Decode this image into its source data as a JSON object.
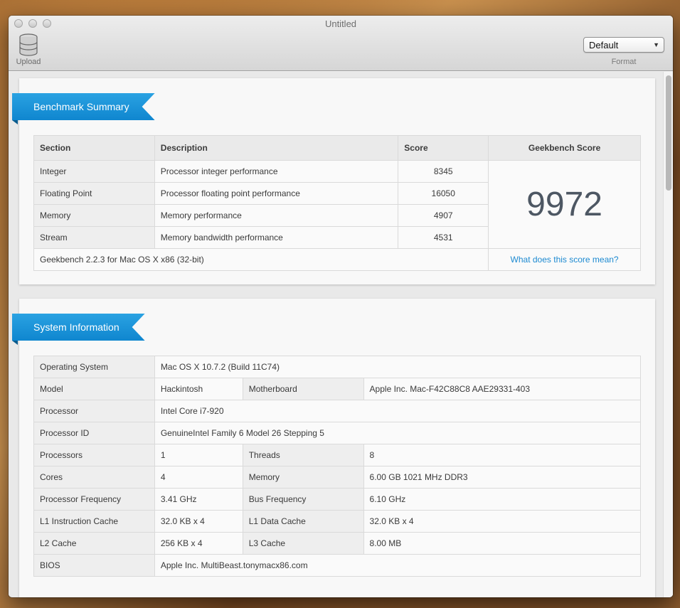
{
  "window": {
    "title": "Untitled"
  },
  "toolbar": {
    "upload_label": "Upload",
    "format_value": "Default",
    "format_label": "Format"
  },
  "summary": {
    "heading": "Benchmark Summary",
    "columns": [
      "Section",
      "Description",
      "Score",
      "Geekbench Score"
    ],
    "rows": [
      {
        "section": "Integer",
        "description": "Processor integer performance",
        "score": "8345"
      },
      {
        "section": "Floating Point",
        "description": "Processor floating point performance",
        "score": "16050"
      },
      {
        "section": "Memory",
        "description": "Memory performance",
        "score": "4907"
      },
      {
        "section": "Stream",
        "description": "Memory bandwidth performance",
        "score": "4531"
      }
    ],
    "geekbench_score": "9972",
    "version": "Geekbench 2.2.3 for Mac OS X x86 (32-bit)",
    "score_link": "What does this score mean?"
  },
  "system": {
    "heading": "System Information",
    "os_label": "Operating System",
    "os_value": "Mac OS X 10.7.2 (Build 11C74)",
    "model_label": "Model",
    "model_value": "Hackintosh",
    "motherboard_label": "Motherboard",
    "motherboard_value": "Apple Inc. Mac-F42C88C8 AAE29331-403",
    "processor_label": "Processor",
    "processor_value": "Intel Core i7-920",
    "processor_id_label": "Processor ID",
    "processor_id_value": "GenuineIntel Family 6 Model 26 Stepping 5",
    "processors_label": "Processors",
    "processors_value": "1",
    "threads_label": "Threads",
    "threads_value": "8",
    "cores_label": "Cores",
    "cores_value": "4",
    "memory_label": "Memory",
    "memory_value": "6.00 GB 1021 MHz DDR3",
    "freq_label": "Processor Frequency",
    "freq_value": "3.41 GHz",
    "bus_label": "Bus Frequency",
    "bus_value": "6.10 GHz",
    "l1i_label": "L1 Instruction Cache",
    "l1i_value": "32.0 KB x 4",
    "l1d_label": "L1 Data Cache",
    "l1d_value": "32.0 KB x 4",
    "l2_label": "L2 Cache",
    "l2_value": "256 KB x 4",
    "l3_label": "L3 Cache",
    "l3_value": "8.00 MB",
    "bios_label": "BIOS",
    "bios_value": "Apple Inc. MultiBeast.tonymacx86.com"
  },
  "colors": {
    "accent": "#1a94da",
    "link": "#1d8ad1",
    "score": "#4d5763"
  }
}
